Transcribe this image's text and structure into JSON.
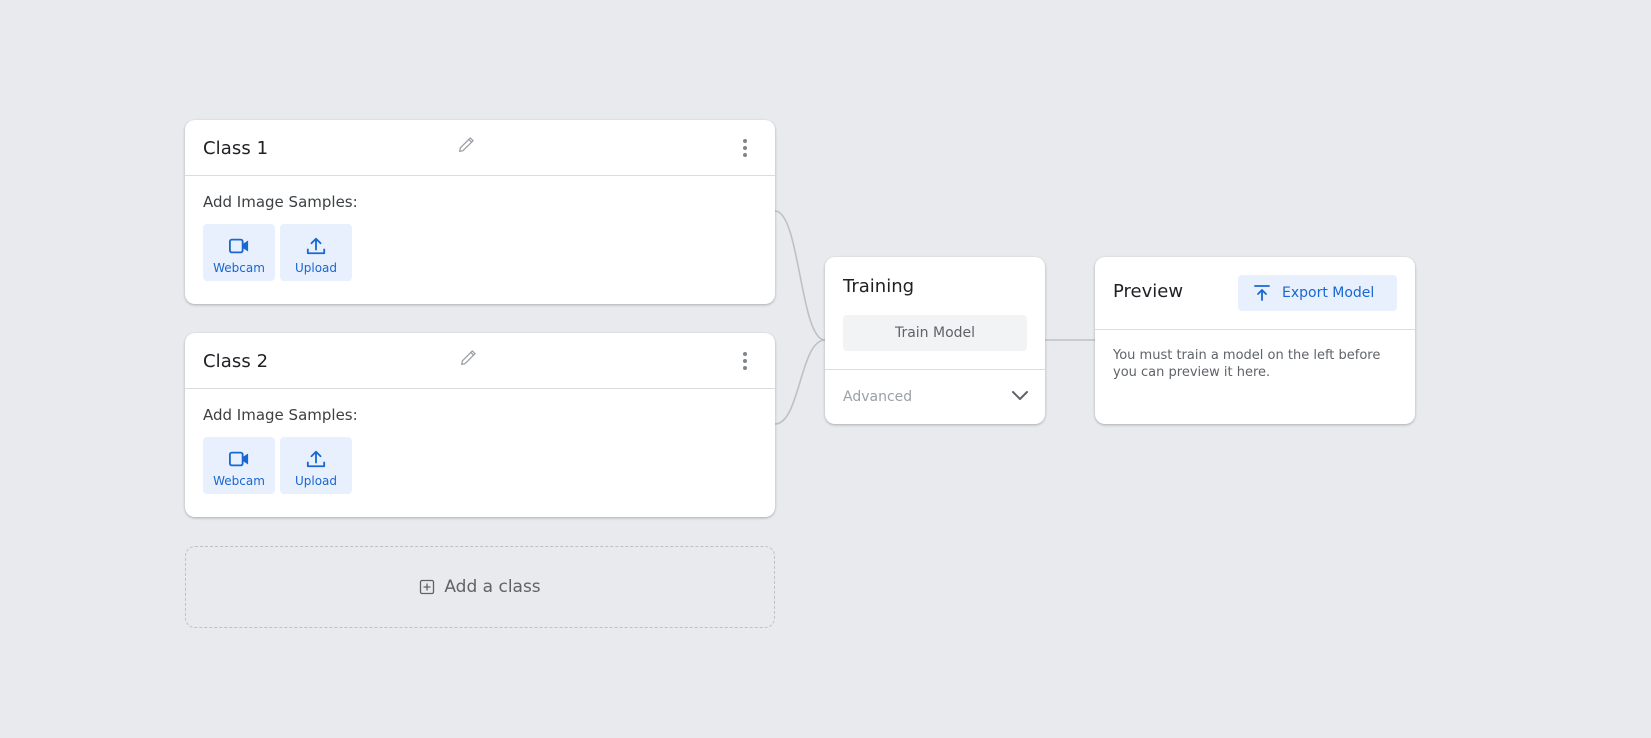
{
  "classes": [
    {
      "title": "Class 1",
      "samples_label": "Add Image Samples:",
      "webcam_label": "Webcam",
      "upload_label": "Upload"
    },
    {
      "title": "Class 2",
      "samples_label": "Add Image Samples:",
      "webcam_label": "Webcam",
      "upload_label": "Upload"
    }
  ],
  "add_class_label": "Add a class",
  "training": {
    "title": "Training",
    "train_button": "Train Model",
    "advanced_label": "Advanced"
  },
  "preview": {
    "title": "Preview",
    "export_button": "Export Model",
    "message": "You must train a model on the left before you can preview it here."
  },
  "icons": {
    "edit": "pencil-icon",
    "more": "more-vert-icon",
    "webcam": "videocam-icon",
    "upload": "upload-icon",
    "add": "add-box-icon",
    "expand": "chevron-down-icon",
    "export": "publish-icon"
  },
  "colors": {
    "background": "#e8eaed",
    "accent": "#1967d2",
    "accent_light": "#e8f0fe"
  }
}
